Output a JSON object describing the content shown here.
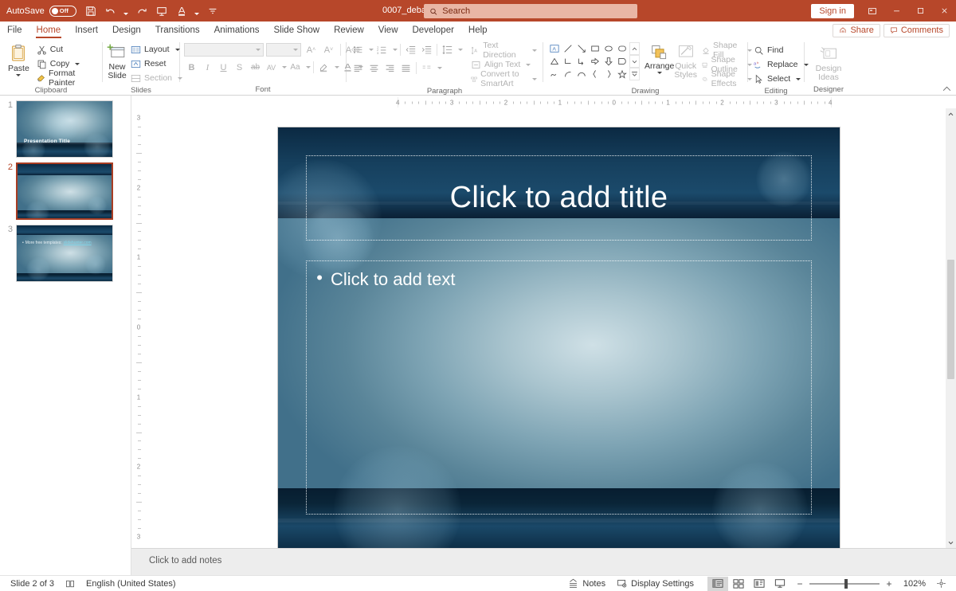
{
  "titlebar": {
    "autosave_label": "AutoSave",
    "autosave_state": "Off",
    "filename": "0007_debate_powerpoint_background.ppt -...",
    "search_placeholder": "Search",
    "search_value": "",
    "signin_label": "Sign in",
    "quick_access": [
      {
        "name": "save-icon",
        "title": "Save"
      },
      {
        "name": "undo-icon",
        "title": "Undo"
      },
      {
        "name": "redo-icon",
        "title": "Redo"
      },
      {
        "name": "start-presentation-icon",
        "title": "Start From Beginning"
      },
      {
        "name": "text-color-icon",
        "title": "Font Color"
      },
      {
        "name": "customize-qat-icon",
        "title": "Customize Quick Access Toolbar"
      }
    ],
    "window_buttons": [
      {
        "name": "ribbon-display-options-icon",
        "glyph": "❐"
      },
      {
        "name": "minimize-icon",
        "glyph": "─"
      },
      {
        "name": "maximize-icon",
        "glyph": "□"
      },
      {
        "name": "close-icon",
        "glyph": "✕"
      }
    ]
  },
  "ribbon_tabs": [
    {
      "label": "File",
      "active": false
    },
    {
      "label": "Home",
      "active": true
    },
    {
      "label": "Insert",
      "active": false
    },
    {
      "label": "Design",
      "active": false
    },
    {
      "label": "Transitions",
      "active": false
    },
    {
      "label": "Animations",
      "active": false
    },
    {
      "label": "Slide Show",
      "active": false
    },
    {
      "label": "Review",
      "active": false
    },
    {
      "label": "View",
      "active": false
    },
    {
      "label": "Developer",
      "active": false
    },
    {
      "label": "Help",
      "active": false
    }
  ],
  "ribbon_right": {
    "share_label": "Share",
    "comments_label": "Comments"
  },
  "groups": {
    "clipboard": {
      "label": "Clipboard",
      "paste_label": "Paste",
      "cut_label": "Cut",
      "copy_label": "Copy",
      "format_painter_label": "Format Painter"
    },
    "slides": {
      "label": "Slides",
      "new_slide_label": "New\nSlide",
      "new_slide_line1": "New",
      "new_slide_line2": "Slide",
      "layout_label": "Layout",
      "reset_label": "Reset",
      "section_label": "Section"
    },
    "font": {
      "label": "Font",
      "font_name_value": "",
      "font_size_value": "",
      "buttons": [
        "Bold",
        "Italic",
        "Underline",
        "Text Shadow",
        "Strikethrough",
        "Character Spacing",
        "Change Case",
        "Text Highlight Color",
        "Font Color",
        "Increase Font Size",
        "Decrease Font Size",
        "Clear All Formatting"
      ]
    },
    "paragraph": {
      "label": "Paragraph",
      "text_direction_label": "Text Direction",
      "align_text_label": "Align Text",
      "convert_smartart_label": "Convert to SmartArt"
    },
    "drawing": {
      "label": "Drawing",
      "arrange_label": "Arrange",
      "quick_styles_line1": "Quick",
      "quick_styles_line2": "Styles",
      "shape_fill_label": "Shape Fill",
      "shape_outline_label": "Shape Outline",
      "shape_effects_label": "Shape Effects"
    },
    "editing": {
      "label": "Editing",
      "find_label": "Find",
      "replace_label": "Replace",
      "select_label": "Select"
    },
    "designer": {
      "label": "Designer",
      "design_ideas_line1": "Design",
      "design_ideas_line2": "Ideas"
    }
  },
  "thumbnails": [
    {
      "number": "1",
      "selected": false,
      "text": "Presentation Title",
      "kind": "title"
    },
    {
      "number": "2",
      "selected": true,
      "text": "",
      "kind": "content"
    },
    {
      "number": "3",
      "selected": false,
      "text": "More free templates:",
      "link": "slidehunter.com",
      "kind": "bullet"
    }
  ],
  "slide": {
    "title_placeholder": "Click to add title",
    "body_placeholder": "Click to add text",
    "bullet_glyph": "•"
  },
  "notes": {
    "placeholder": "Click to add notes"
  },
  "rulers": {
    "horizontal_ticks": [
      "4",
      "3",
      "2",
      "1",
      "0",
      "1",
      "2",
      "3",
      "4"
    ],
    "vertical_ticks": [
      "3",
      "2",
      "1",
      "0",
      "1",
      "2",
      "3"
    ],
    "units": "inches"
  },
  "statusbar": {
    "slide_counter": "Slide 2 of 3",
    "language": "English (United States)",
    "notes_label": "Notes",
    "display_settings_label": "Display Settings",
    "zoom_value": "102%",
    "zoom_minus": "−",
    "zoom_plus": "+",
    "views": [
      {
        "name": "normal-view-button",
        "active": true
      },
      {
        "name": "slide-sorter-view-button",
        "active": false
      },
      {
        "name": "reading-view-button",
        "active": false
      },
      {
        "name": "slide-show-button",
        "active": false
      }
    ],
    "fit_slide_label": "Fit slide to current window"
  },
  "colors": {
    "accent": "#b7472a",
    "titlebar": "#b7472a",
    "selection_border": "#a93d23",
    "slide_dark": "#0b2942",
    "slide_light": "#a9c4ce"
  }
}
